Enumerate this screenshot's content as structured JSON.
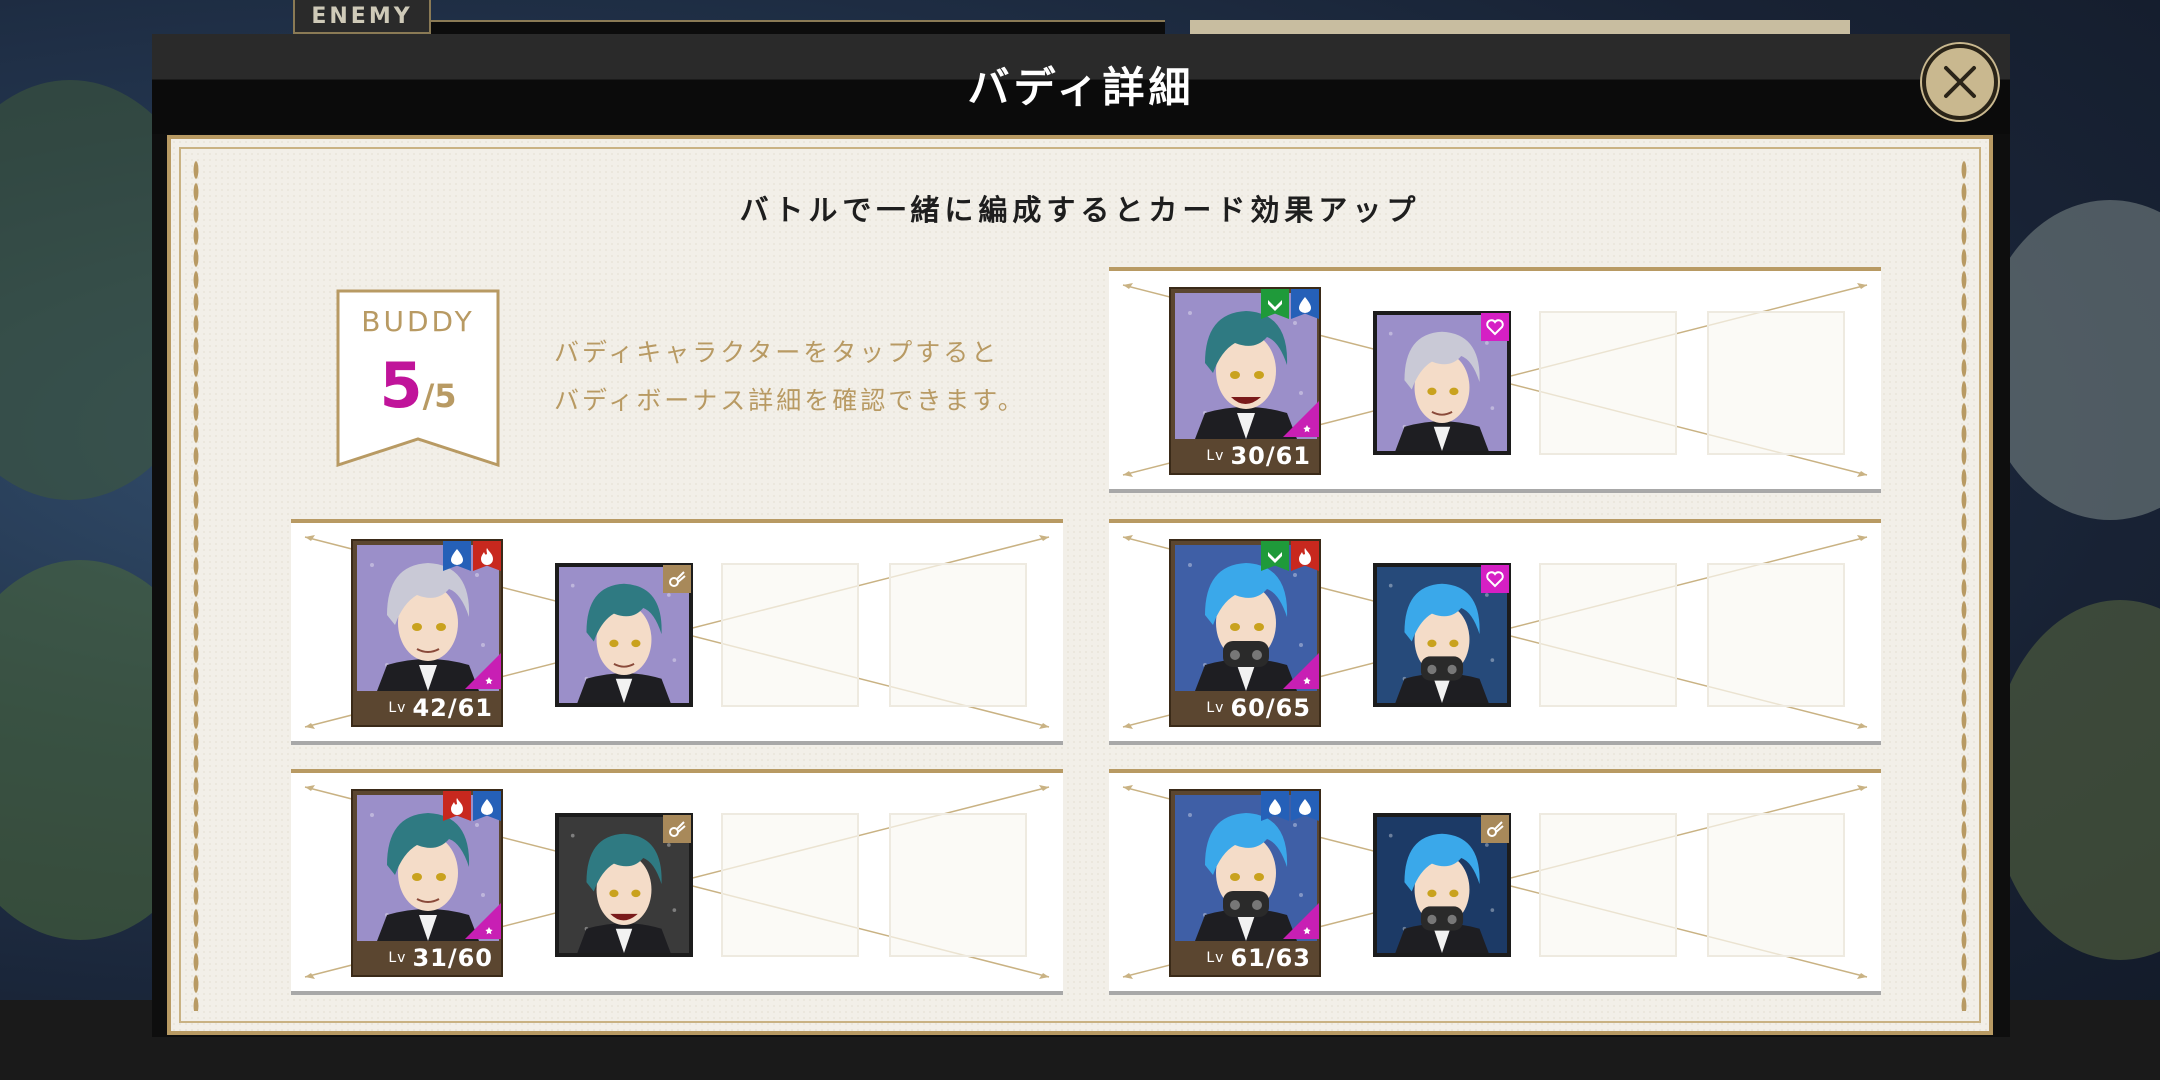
{
  "enemy_tab": "ENEMY",
  "modal": {
    "title": "バディ詳細"
  },
  "panel": {
    "subtitle": "バトルで一緒に編成するとカード効果アップ",
    "buddy_label": "BUDDY",
    "buddy_count": "5",
    "buddy_max": "/5",
    "hint_line1": "バディキャラクターをタップすると",
    "hint_line2": "バディボーナス詳細を確認できます。"
  },
  "colors": {
    "accent_gold": "#b89a63",
    "count_magenta": "#c0149a"
  },
  "rows": [
    {
      "lv_prefix": "Lv",
      "level": "30/61",
      "main_bg": "#9b8fc9",
      "main_hair": "#2f7a82",
      "main_mouth": "grin",
      "badges": [
        "green-chevron",
        "blue-water"
      ],
      "sub_bg": "#9b8fc9",
      "sub_hair": "#c9c9d6",
      "sub_tag": "heart"
    },
    {
      "lv_prefix": "Lv",
      "level": "42/61",
      "main_bg": "#9b8fc9",
      "main_hair": "#c9c9d6",
      "main_mouth": "smile",
      "badges": [
        "blue-water",
        "red-fire"
      ],
      "sub_bg": "#9b8fc9",
      "sub_hair": "#2f7a82",
      "sub_tag": "comet"
    },
    {
      "lv_prefix": "Lv",
      "level": "60/65",
      "main_bg": "#3f5fa6",
      "main_hair": "#3aa8ea",
      "main_mouth": "mask",
      "badges": [
        "green-chevron",
        "red-fire"
      ],
      "sub_bg": "#264a7a",
      "sub_hair": "#3aa8ea",
      "sub_tag": "heart"
    },
    {
      "lv_prefix": "Lv",
      "level": "31/60",
      "main_bg": "#9b8fc9",
      "main_hair": "#2f7a82",
      "main_mouth": "smile",
      "badges": [
        "red-fire",
        "blue-water"
      ],
      "sub_bg": "#3a3a3a",
      "sub_hair": "#2f7a82",
      "sub_tag": "comet"
    },
    {
      "lv_prefix": "Lv",
      "level": "61/63",
      "main_bg": "#3f5fa6",
      "main_hair": "#3aa8ea",
      "main_mouth": "mask",
      "badges": [
        "blue-water",
        "blue-water"
      ],
      "sub_bg": "#1c3a66",
      "sub_hair": "#3aa8ea",
      "sub_tag": "comet"
    }
  ]
}
